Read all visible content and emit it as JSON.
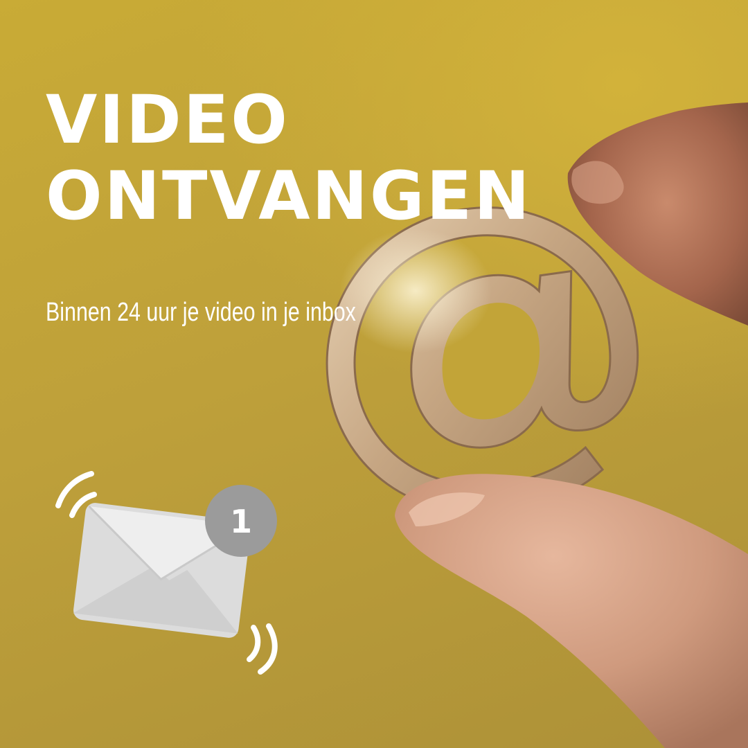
{
  "headline": {
    "line1": "VIDEO",
    "line2": "ONTVANGEN"
  },
  "subtitle": "Binnen 24 uur je video in je inbox",
  "notification": {
    "icon": "envelope-icon",
    "badge_count": "1"
  },
  "photo": {
    "subject": "at-sign-icon"
  },
  "colors": {
    "background": "#c2a438",
    "text": "#ffffff",
    "envelope": "#e3e3e3",
    "badge": "#9b9b9b"
  }
}
